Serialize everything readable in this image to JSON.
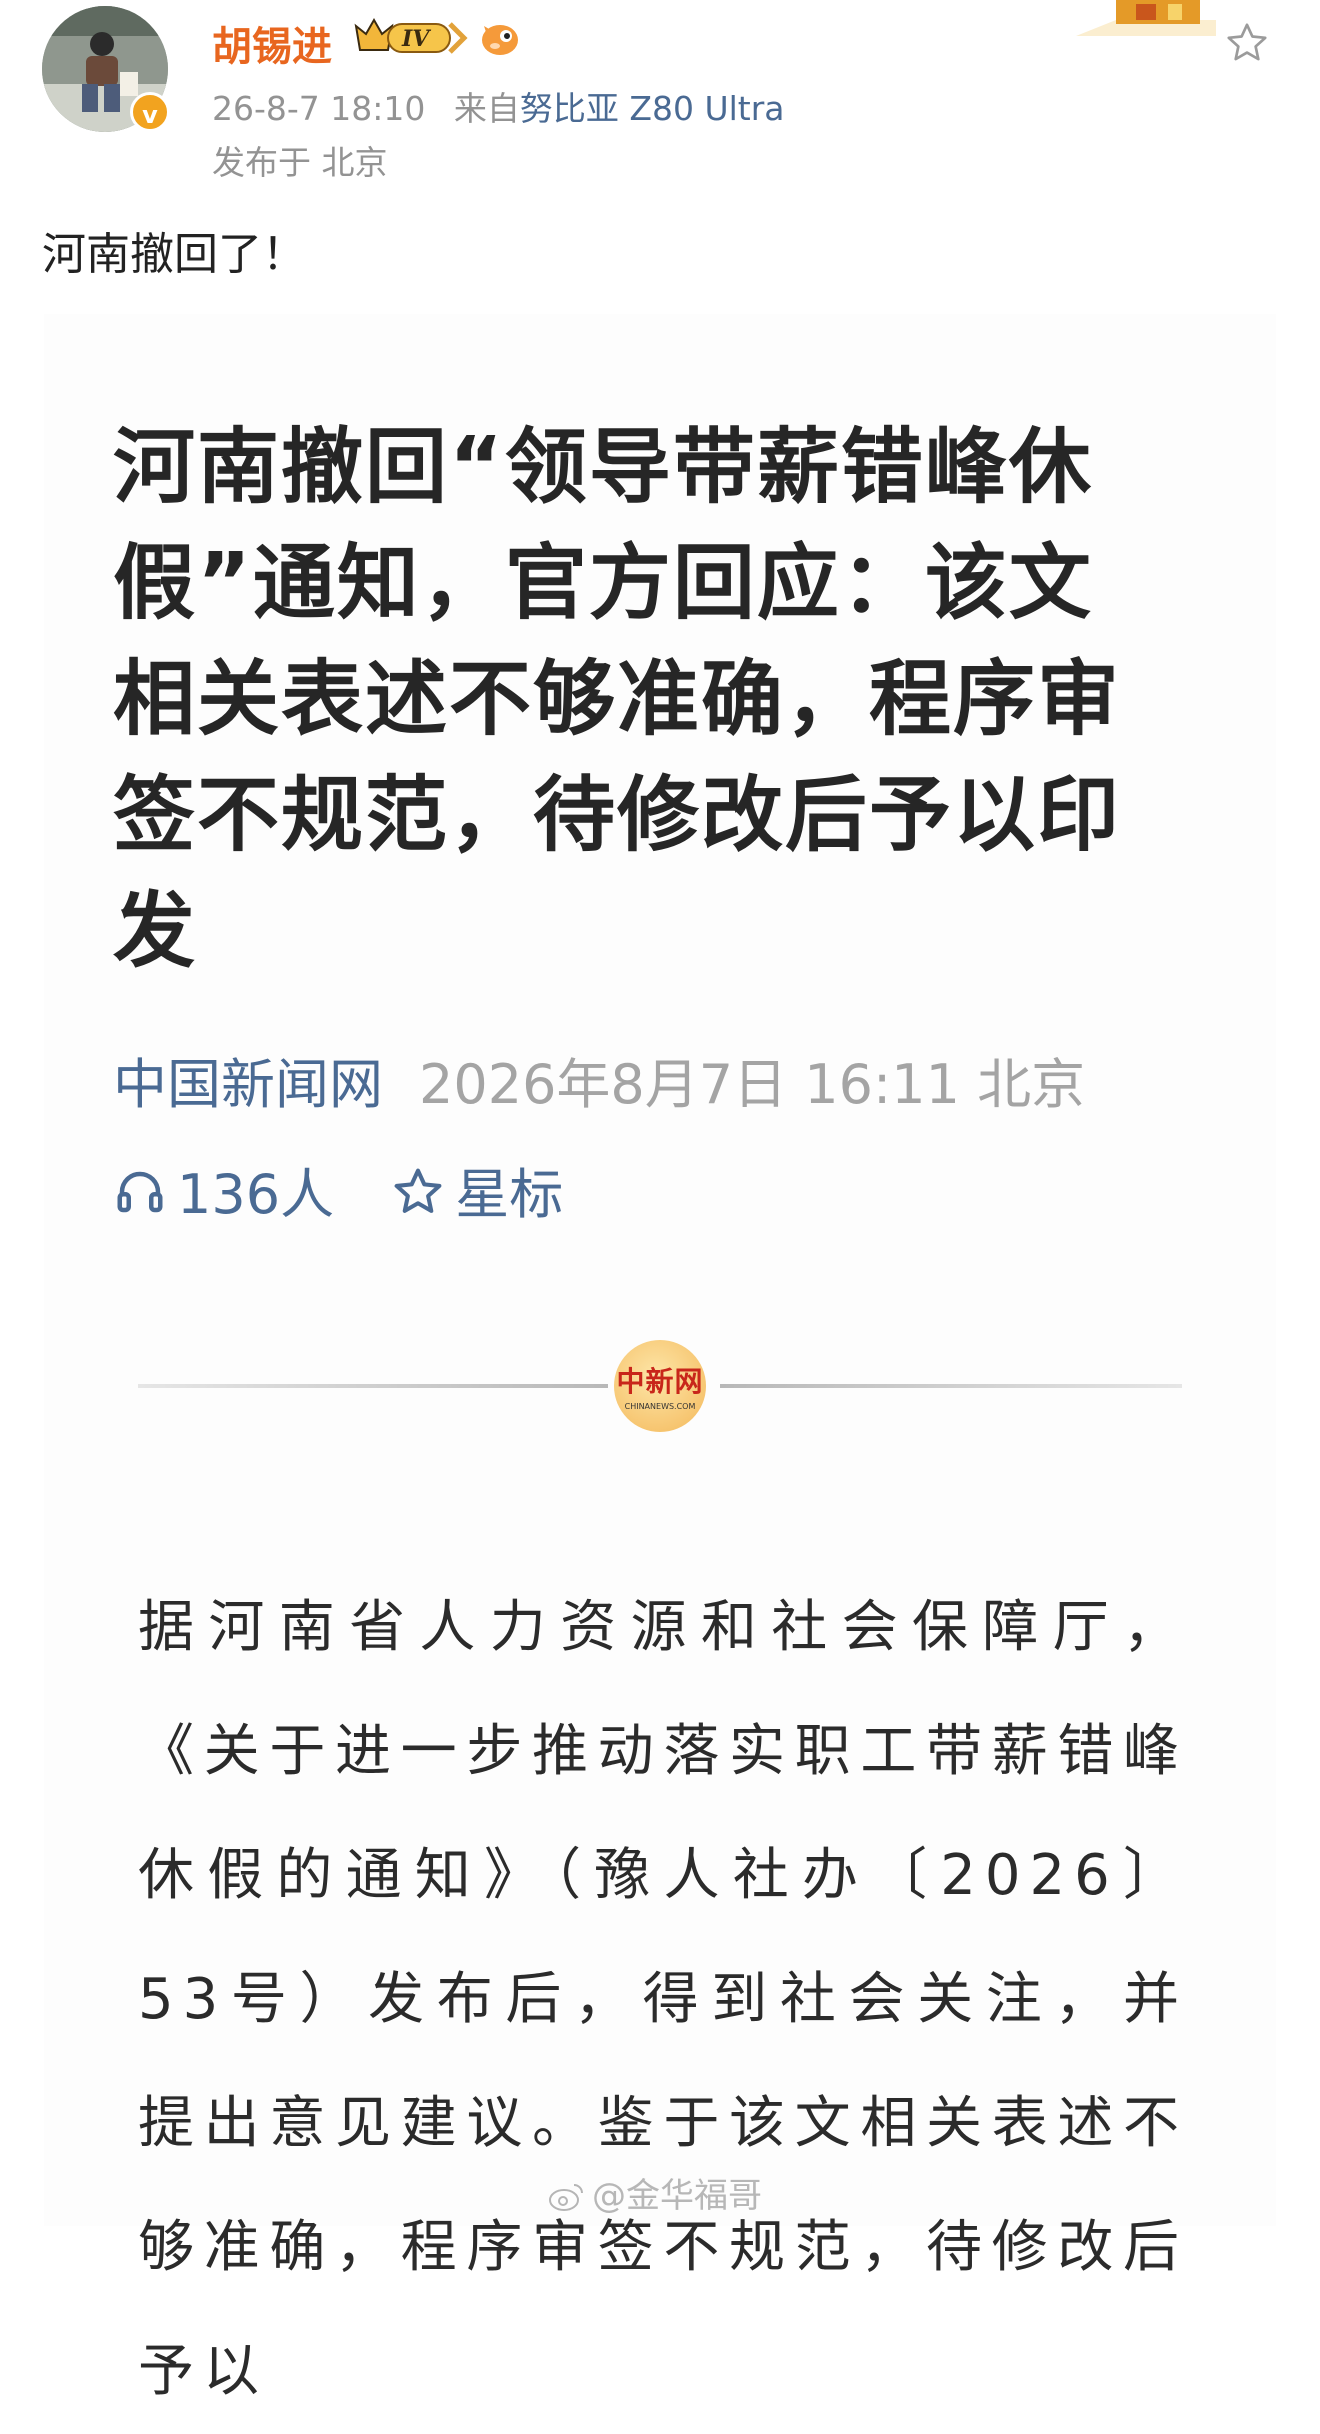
{
  "post": {
    "user_name": "胡锡进",
    "vip_level": "IV",
    "timestamp": "26-8-7 18:10",
    "source_prefix": "来自",
    "device": "努比亚 Z80 Ultra",
    "location_line": "发布于 北京",
    "text": "河南撤回了！",
    "verified_mark": "v"
  },
  "article": {
    "title": "河南撤回“领导带薪错峰休假”通知，官方回应：该文相关表述不够准确，程序审签不规范，待修改后予以印发",
    "source": "中国新闻网",
    "datetime_location": "2026年8月7日 16:11  北京",
    "listen_count": "136人",
    "star_label": "星标",
    "logo_text_cn": "中新网",
    "logo_text_en": "CHINANEWS.COM",
    "body": "据河南省人力资源和社会保障厅，《关于进一步推动落实职工带薪错峰休假的通知》（豫人社办〔2026〕53号）发布后，得到社会关注，并提出意见建议。鉴于该文相关表述不够准确，程序审签不规范，待修改后予以"
  },
  "watermark": "@金华福哥",
  "colors": {
    "name_orange": "#e8661f",
    "link_blue": "#4a6a93",
    "meta_gray": "#939393"
  },
  "icons": [
    "avatar",
    "verified-badge-icon",
    "vip-crown-icon",
    "fish-icon",
    "star-outline-icon",
    "headphones-icon",
    "weibo-icon"
  ]
}
